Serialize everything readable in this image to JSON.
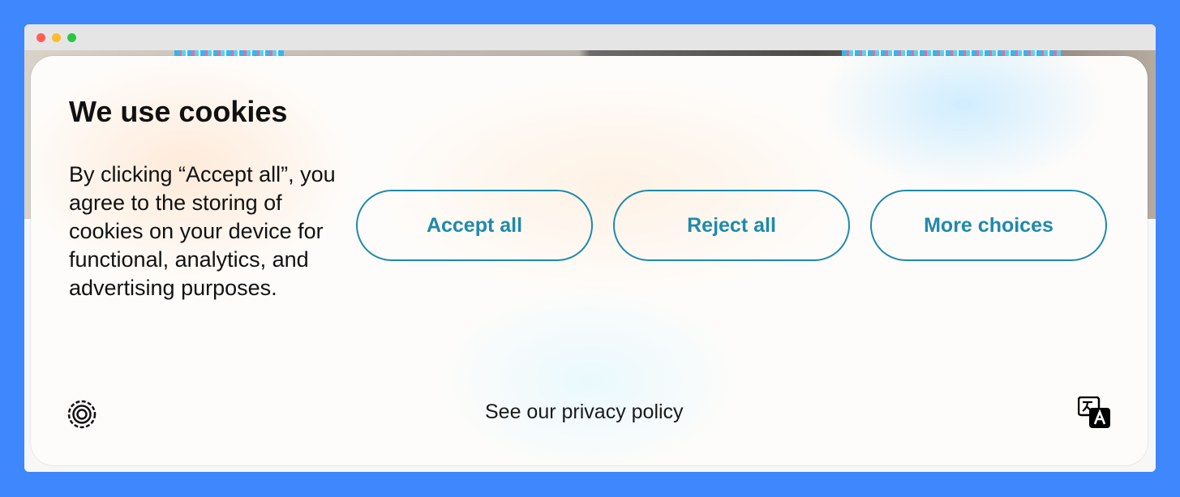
{
  "window": {
    "traffic_lights": [
      "close",
      "minimize",
      "zoom"
    ]
  },
  "cookie_banner": {
    "title": "We use cookies",
    "description": "By clicking “Accept all”, you agree to the storing of cookies on your device for functional, analytics, and advertising purposes.",
    "buttons": {
      "accept_all": "Accept all",
      "reject_all": "Reject all",
      "more_choices": "More choices"
    },
    "privacy_link": "See our privacy policy",
    "icons": {
      "brand": "consent-logo-icon",
      "language": "translate-icon"
    }
  },
  "colors": {
    "page_background": "#3f87fd",
    "accent": "#1f8aab",
    "text": "#111111"
  }
}
